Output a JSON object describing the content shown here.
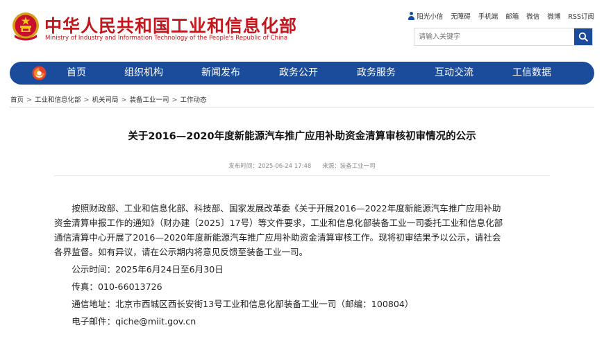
{
  "header": {
    "title_cn": "中华人民共和国工业和信息化部",
    "title_en": "Ministry of Industry and Information Technology of the People's Republic of China",
    "top_links": [
      "阳光小信",
      "无障碍",
      "手机端",
      "邮箱",
      "微信",
      "微博",
      "RSS订阅"
    ],
    "search_placeholder": "请输入关键字"
  },
  "nav": {
    "items": [
      "首页",
      "组织机构",
      "新闻发布",
      "政务公开",
      "政务服务",
      "互动交流",
      "工信数据"
    ]
  },
  "breadcrumb": [
    "首页",
    "工业和信息化部",
    "机关司局",
    "装备工业一司",
    "工作动态"
  ],
  "article": {
    "title": "关于2016—2020年度新能源汽车推广应用补助资金清算审核初审情况的公示",
    "publish_time": "发布时间：2025-06-24 17:48",
    "source": "来源：装备工业一司",
    "paragraph_lines": [
      "按照财政部、工业和信息化部、科技部、国家发展改革委《关于开展2016—2022年度新能源汽车推广应用补助",
      "资金清算申报工作的通知》（财办建〔2025〕17号）等文件要求，工业和信息化部装备工业一司委托工业和信息化部",
      "通信清算中心开展了2016—2020年度新能源汽车推广应用补助资金清算审核工作。现将初审结果予以公示，请社会",
      "各界监督。如有异议，请在公示期内将意见反馈至装备工业一司。"
    ],
    "period": "公示时间：2025年6月24日至6月30日",
    "fax": "传真：010-66013726",
    "address": "通信地址：北京市西城区西长安街13号工业和信息化部装备工业一司（邮编：100804）",
    "email": "电子邮件：qiche@miit.gov.cn"
  },
  "colors": {
    "brand_red": "#c4161c",
    "nav_blue": "#1b4c9c"
  }
}
